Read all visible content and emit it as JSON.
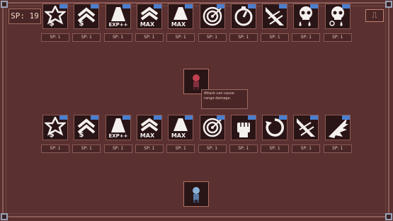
{
  "hud": {
    "sp_label": "SP: 19",
    "exit_icon": "exit-door-icon"
  },
  "tooltip": {
    "text": "Attack can cause range damage."
  },
  "row1": [
    {
      "icon": "hexagram-dollar",
      "badge": "",
      "cost": "SP: 1"
    },
    {
      "icon": "chevrons-dollar",
      "badge": "",
      "cost": "SP: 1"
    },
    {
      "icon": "beam-exp",
      "badge": "",
      "cost": "SP: 1"
    },
    {
      "icon": "chevrons-max",
      "badge": "",
      "cost": "SP: 1"
    },
    {
      "icon": "beam-max",
      "badge": "",
      "cost": "SP: 1"
    },
    {
      "icon": "target",
      "badge": "",
      "cost": "SP: 1"
    },
    {
      "icon": "stopwatch",
      "badge": "",
      "cost": "SP: 1"
    },
    {
      "icon": "burst-arrow",
      "badge": "",
      "cost": "SP: 1"
    },
    {
      "icon": "skull-drop",
      "badge": "",
      "cost": "SP: 1"
    },
    {
      "icon": "skull-drop-cycle",
      "badge": "",
      "cost": "SP: 1"
    }
  ],
  "row2": [
    {
      "icon": "hexagram-dollar",
      "badge": "",
      "cost": "SP: 1"
    },
    {
      "icon": "chevrons-dollar",
      "badge": "",
      "cost": "SP: 1"
    },
    {
      "icon": "beam-exp",
      "badge": "",
      "cost": "SP: 1"
    },
    {
      "icon": "chevrons-max",
      "badge": "",
      "cost": "SP: 1"
    },
    {
      "icon": "beam-max",
      "badge": "",
      "cost": "SP: 1"
    },
    {
      "icon": "target",
      "badge": "",
      "cost": "SP: 1"
    },
    {
      "icon": "fist",
      "badge": "",
      "cost": "SP: 1"
    },
    {
      "icon": "cycle-arrow",
      "badge": "",
      "cost": "SP: 1"
    },
    {
      "icon": "burst-arrow",
      "badge": "",
      "cost": "SP: 1"
    },
    {
      "icon": "spike-burst",
      "badge": "",
      "cost": "SP: 1"
    }
  ],
  "text_labels": {
    "exp": "EXP++",
    "max": "MAX",
    "dollar": "$"
  },
  "colors": {
    "badge": "#4a7fd0",
    "panel": "#5b3030",
    "frame": "#8a5a55"
  }
}
